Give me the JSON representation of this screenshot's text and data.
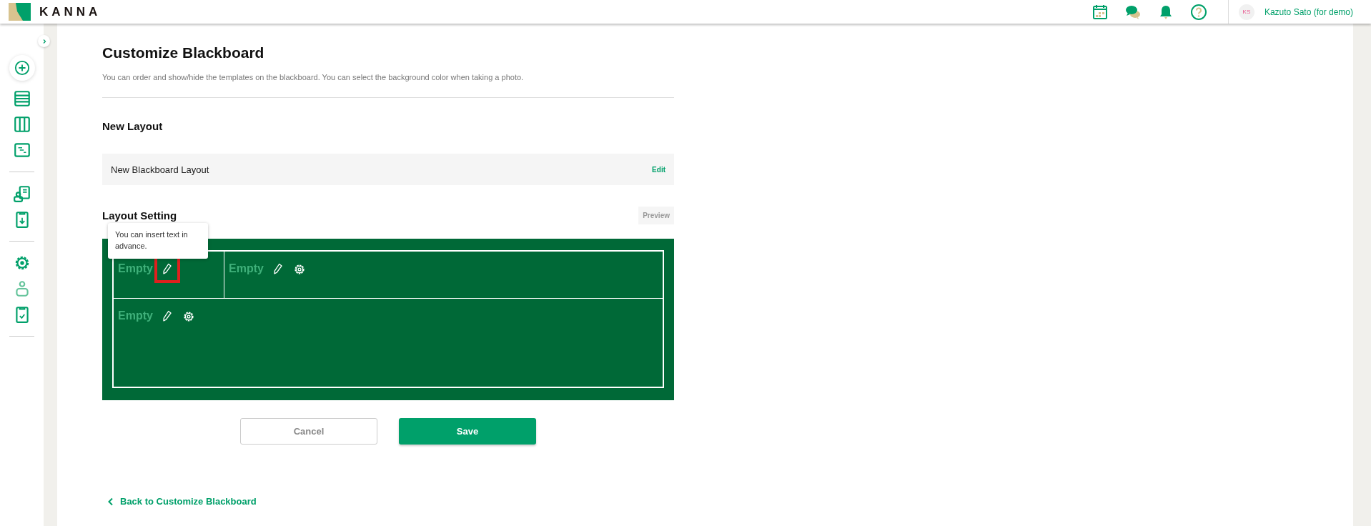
{
  "header": {
    "brand": "KANNA",
    "user": {
      "initials": "KS",
      "name": "Kazuto Sato (for demo)"
    }
  },
  "page": {
    "title": "Customize Blackboard",
    "description": "You can order and show/hide the templates on the blackboard. You can select the background color when taking a photo.",
    "new_layout": {
      "heading": "New Layout",
      "name": "New Blackboard Layout",
      "edit": "Edit"
    },
    "layout_setting": {
      "heading": "Layout Setting",
      "preview": "Preview",
      "tooltip": "You can insert text in advance.",
      "rows": [
        {
          "cells": [
            {
              "label": "Empty",
              "kind": "pencil",
              "highlighted": true
            },
            {
              "label": "Empty",
              "kind": "pencil-gear",
              "highlighted": false
            }
          ]
        },
        {
          "cells": [
            {
              "label": "Empty",
              "kind": "pencil-gear",
              "highlighted": false
            }
          ]
        }
      ]
    },
    "buttons": {
      "cancel": "Cancel",
      "save": "Save"
    },
    "back_link": "Back to Customize Blackboard"
  }
}
